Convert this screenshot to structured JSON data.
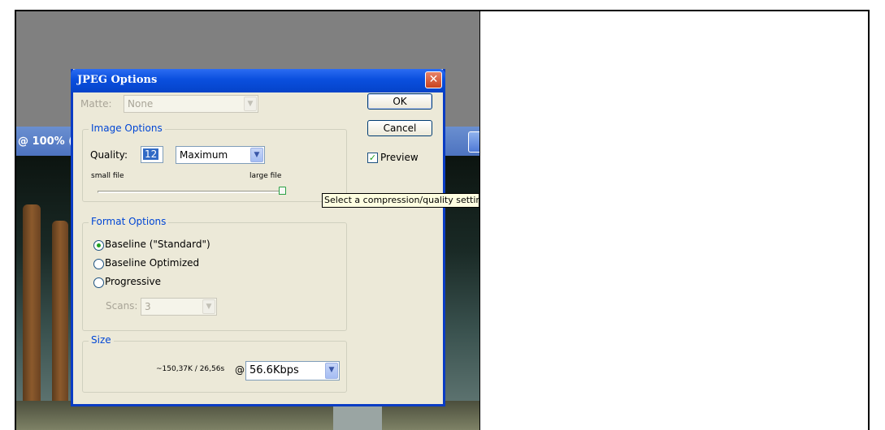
{
  "background": {
    "zoom_label": "@ 100% ("
  },
  "dialog": {
    "title": "JPEG Options",
    "close_glyph": "✕",
    "matte": {
      "label": "Matte:",
      "value": "None"
    },
    "ok_label": "OK",
    "cancel_label": "Cancel",
    "preview": {
      "label": "Preview",
      "checked": true
    },
    "image_options": {
      "legend": "Image Options",
      "quality_label": "Quality:",
      "quality_value": "12",
      "quality_preset": "Maximum",
      "small_file_label": "small file",
      "large_file_label": "large file",
      "slider_level": 1.0
    },
    "format_options": {
      "legend": "Format Options",
      "options": [
        {
          "label": "Baseline (\"Standard\")",
          "selected": true
        },
        {
          "label": "Baseline Optimized",
          "selected": false
        },
        {
          "label": "Progressive",
          "selected": false
        }
      ],
      "scans_label": "Scans:",
      "scans_value": "3"
    },
    "size": {
      "legend": "Size",
      "estimate": "~150,37K / 26,56s",
      "at_symbol": "@",
      "speed": "56.6Kbps"
    }
  },
  "tooltip": {
    "text": "Select a compression/quality setting"
  },
  "colors": {
    "titlebar": "#0a4fde",
    "legend_text": "#0046d5",
    "dialog_bg": "#ece9d8",
    "tooltip_bg": "#ffffe1"
  },
  "icons": {
    "close": "close-icon",
    "dropdown": "chevron-down-icon",
    "check": "checkmark-icon"
  }
}
